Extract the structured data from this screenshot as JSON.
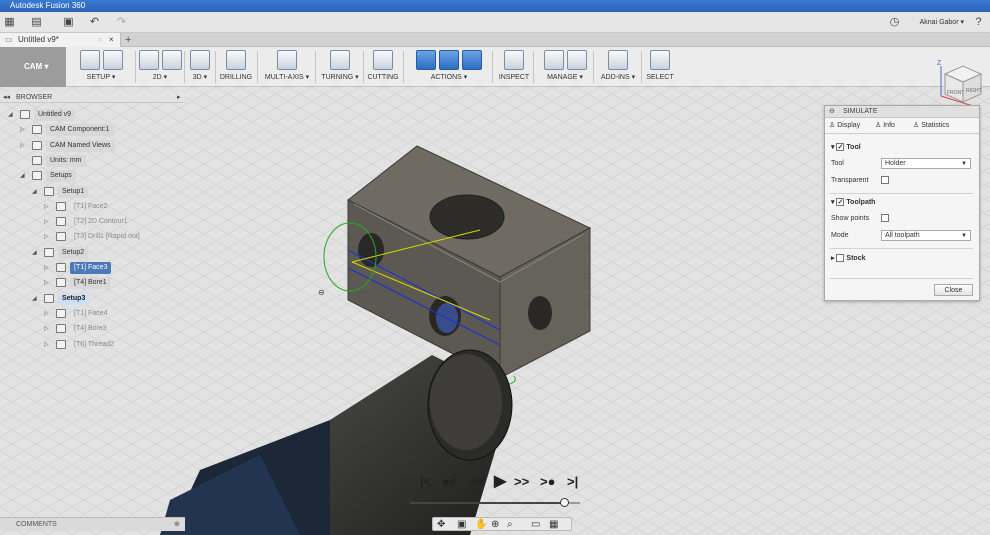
{
  "titlebar": {
    "title": "Autodesk Fusion 360"
  },
  "qat": {
    "user": "Aknai Gabor ▾"
  },
  "doc_tab": {
    "title": "Untitled v9*",
    "close": "×",
    "add": "+"
  },
  "ribbon": {
    "workspace": "CAM ▾",
    "groups": [
      {
        "label": "SETUP ▾",
        "icons": 2
      },
      {
        "label": "2D ▾",
        "icons": 2
      },
      {
        "label": "3D ▾",
        "icons": 1
      },
      {
        "label": "DRILLING",
        "icons": 1
      },
      {
        "label": "MULTI-AXIS ▾",
        "icons": 1
      },
      {
        "label": "TURNING ▾",
        "icons": 1
      },
      {
        "label": "CUTTING",
        "icons": 1
      },
      {
        "label": "ACTIONS ▾",
        "icons": 3
      },
      {
        "label": "INSPECT",
        "icons": 1
      },
      {
        "label": "MANAGE ▾",
        "icons": 2
      },
      {
        "label": "ADD-INS ▾",
        "icons": 1
      },
      {
        "label": "SELECT",
        "icons": 1
      }
    ]
  },
  "browser": {
    "header": "BROWSER",
    "nodes": [
      {
        "label": "Untitled v9",
        "style": "plain"
      },
      {
        "label": "CAM Component:1",
        "style": "plain"
      },
      {
        "label": "CAM Named Views",
        "style": "plain"
      },
      {
        "label": "Units: mm",
        "style": "plain"
      },
      {
        "label": "Setups",
        "style": "plain"
      },
      {
        "label": "Setup1",
        "style": "plain"
      },
      {
        "label": "[T1] Face2",
        "style": "dim"
      },
      {
        "label": "[T2] 2D Contour1",
        "style": "dim"
      },
      {
        "label": "[T3] Drill1 [Rapid out]",
        "style": "dim"
      },
      {
        "label": "Setup2",
        "style": "plain"
      },
      {
        "label": "[T1] Face3",
        "style": "sel"
      },
      {
        "label": "[T4] Bore1",
        "style": "plain"
      },
      {
        "label": "Setup3",
        "style": "hi"
      },
      {
        "label": "[T1] Face4",
        "style": "dim"
      },
      {
        "label": "[T4] Bore3",
        "style": "dim"
      },
      {
        "label": "[T6] Thread2",
        "style": "dim"
      }
    ]
  },
  "simulate": {
    "title": "SIMULATE",
    "tabs": [
      "Display",
      "Info",
      "Statistics"
    ],
    "tool_section": "Tool",
    "tool_label": "Tool",
    "tool_value": "Holder",
    "transparent_label": "Transparent",
    "toolpath_section": "Toolpath",
    "show_points_label": "Show points",
    "mode_label": "Mode",
    "mode_value": "All toolpath",
    "stock_section": "Stock",
    "close_label": "Close"
  },
  "comments": {
    "label": "COMMENTS"
  },
  "viewcube": {
    "front": "FRONT",
    "right": "RIGHT",
    "axis_z": "Z",
    "axis_x": "X"
  },
  "playback": {
    "progress": 0.91
  }
}
